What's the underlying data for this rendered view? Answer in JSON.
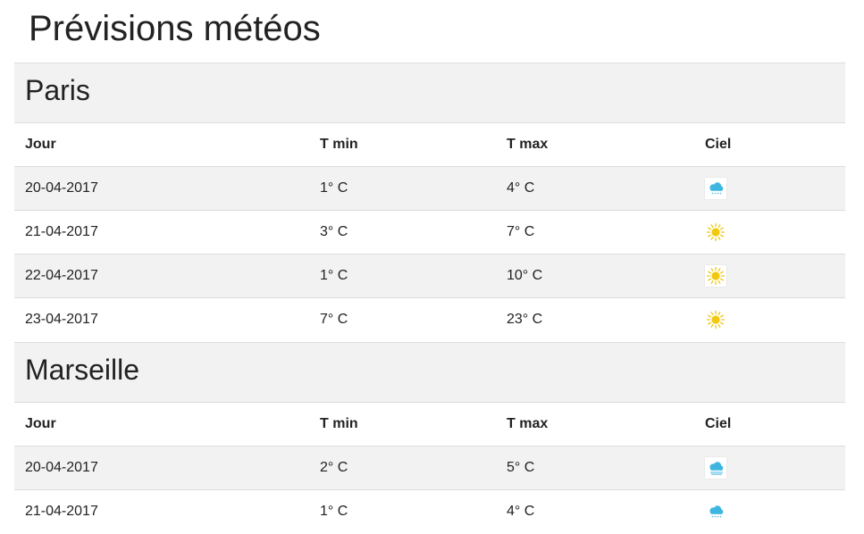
{
  "page": {
    "title": "Prévisions météos"
  },
  "columns": {
    "day": "Jour",
    "tmin": "T min",
    "tmax": "T max",
    "sky": "Ciel"
  },
  "cities": [
    {
      "name": "Paris",
      "rows": [
        {
          "date": "20-04-2017",
          "tmin": "1° C",
          "tmax": "4° C",
          "sky": "rain-cloud-icon"
        },
        {
          "date": "21-04-2017",
          "tmin": "3° C",
          "tmax": "7° C",
          "sky": "sun-icon"
        },
        {
          "date": "22-04-2017",
          "tmin": "1° C",
          "tmax": "10° C",
          "sky": "sun-icon"
        },
        {
          "date": "23-04-2017",
          "tmin": "7° C",
          "tmax": "23° C",
          "sky": "sun-icon"
        }
      ]
    },
    {
      "name": "Marseille",
      "rows": [
        {
          "date": "20-04-2017",
          "tmin": "2° C",
          "tmax": "5° C",
          "sky": "fog-cloud-icon"
        },
        {
          "date": "21-04-2017",
          "tmin": "1° C",
          "tmax": "4° C",
          "sky": "rain-cloud-icon"
        }
      ]
    }
  ],
  "colors": {
    "sun": "#f2c80f",
    "cloud": "#3fb6e0",
    "row_alt": "#f2f2f2",
    "text": "#222222"
  }
}
